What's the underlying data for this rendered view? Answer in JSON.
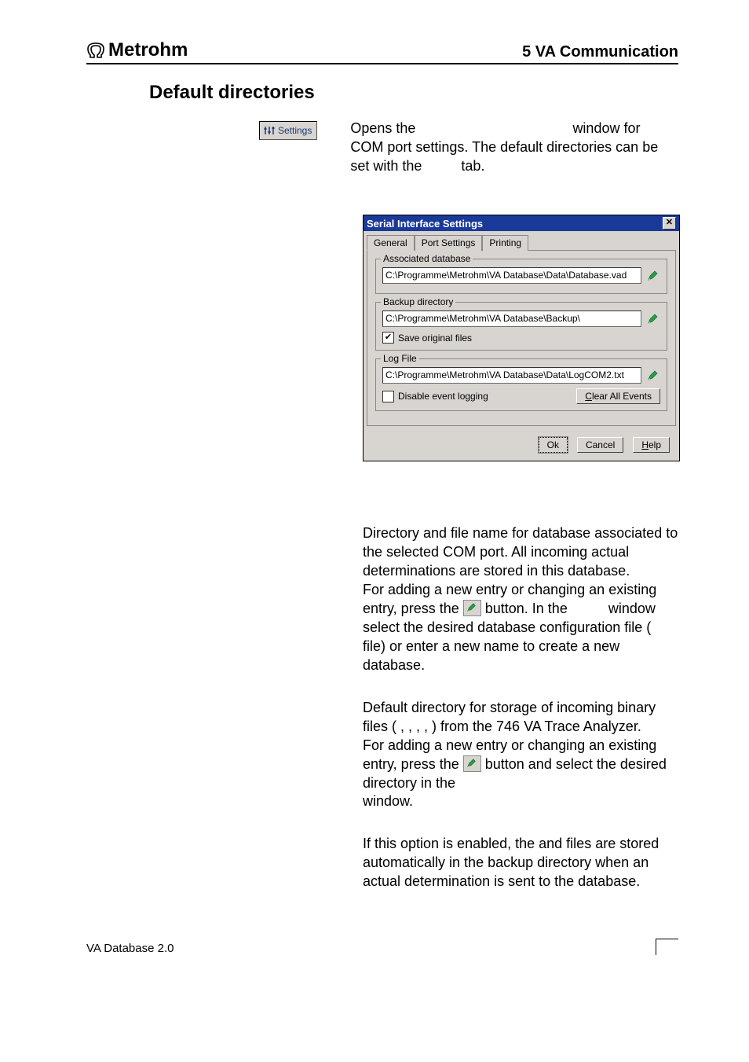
{
  "header": {
    "brand": "Metrohm",
    "chapter": "5  VA Communication"
  },
  "section_title": "Default directories",
  "settings_button": {
    "label": "Settings"
  },
  "intro": {
    "p1a": "Opens the ",
    "p1b": " window for COM port settings. The default directories can be set with the ",
    "p1c": " tab."
  },
  "dialog": {
    "title": "Serial Interface Settings",
    "tabs": {
      "general": "General",
      "port": "Port Settings",
      "printing": "Printing"
    },
    "assoc": {
      "legend": "Associated database",
      "path": "C:\\Programme\\Metrohm\\VA Database\\Data\\Database.vad"
    },
    "backup": {
      "legend": "Backup directory",
      "path": "C:\\Programme\\Metrohm\\VA Database\\Backup\\",
      "save_orig": "Save original files"
    },
    "log": {
      "legend": "Log File",
      "path": "C:\\Programme\\Metrohm\\VA Database\\Data\\LogCOM2.txt",
      "disable": "Disable event logging",
      "clear": "Clear All Events"
    },
    "buttons": {
      "ok": "Ok",
      "cancel": "Cancel",
      "help_pre": "H",
      "help_rest": "elp"
    }
  },
  "body": {
    "assoc1": "Directory and file name for database associated to the selected COM port. All incoming actual determinations are stored in this database.",
    "assoc2a": "For adding a new entry or changing an existing entry, press the ",
    "assoc2b": " button. In the ",
    "assoc2c": " window select the desired database configuration file (",
    "assoc2d": " file) or enter a new name to create a new database.",
    "backup1": "Default directory for storage of incoming binary files (       ,        ,        ,        ,       ) from the 746 VA Trace Analyzer.",
    "backup2a": "For adding a new entry or changing an existing entry, press the ",
    "backup2b": " button and select the desired directory in the ",
    "backup2c": " window.",
    "save1": "If this option is enabled, the         and         files are stored automatically in the backup directory when an actual determination is sent to the database."
  },
  "footer": {
    "left": "VA Database 2.0"
  }
}
